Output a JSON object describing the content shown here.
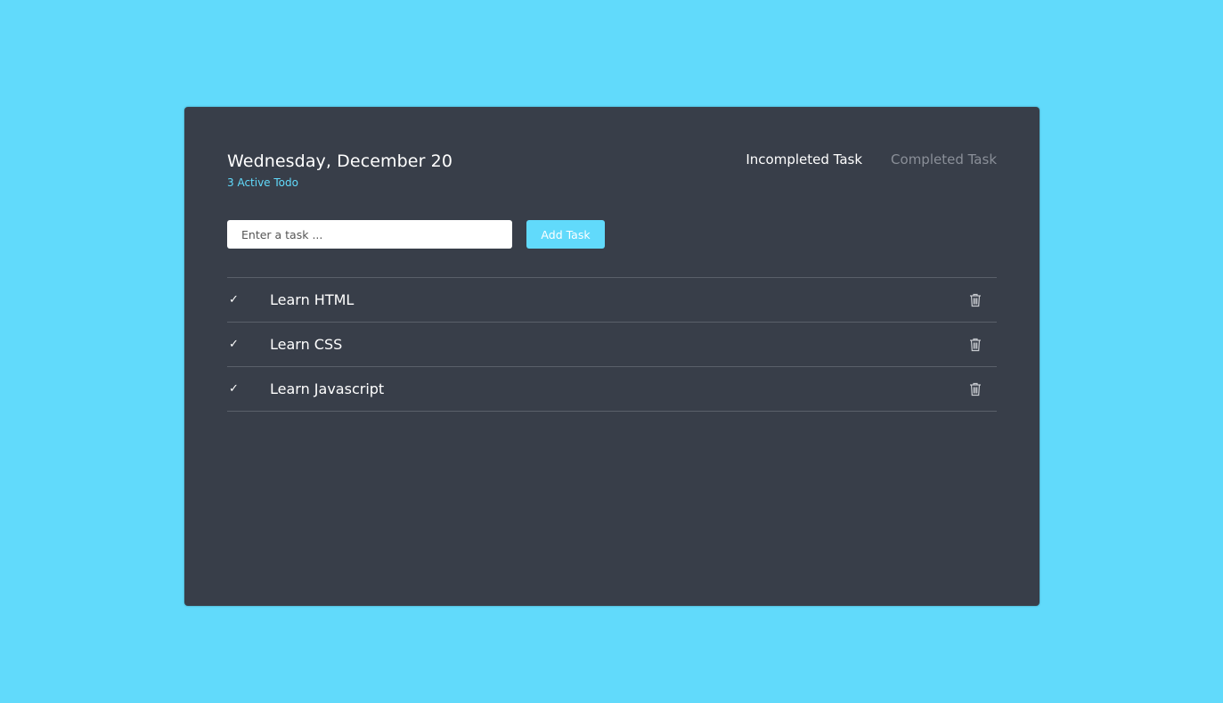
{
  "header": {
    "date": "Wednesday, December 20",
    "active_count": "3 Active Todo"
  },
  "tabs": [
    {
      "label": "Incompleted Task",
      "active": true
    },
    {
      "label": "Completed Task",
      "active": false
    }
  ],
  "form": {
    "placeholder": "Enter a task ...",
    "value": "",
    "add_label": "Add Task"
  },
  "tasks": [
    {
      "label": "Learn HTML",
      "check_icon": "check-icon",
      "delete_icon": "trash-icon"
    },
    {
      "label": "Learn CSS",
      "check_icon": "check-icon",
      "delete_icon": "trash-icon"
    },
    {
      "label": "Learn Javascript",
      "check_icon": "check-icon",
      "delete_icon": "trash-icon"
    }
  ],
  "colors": {
    "background": "#61dafb",
    "card": "#383e49",
    "accent": "#61dafb",
    "divider": "#5a606a",
    "inactive_tab": "#8a8f98"
  }
}
